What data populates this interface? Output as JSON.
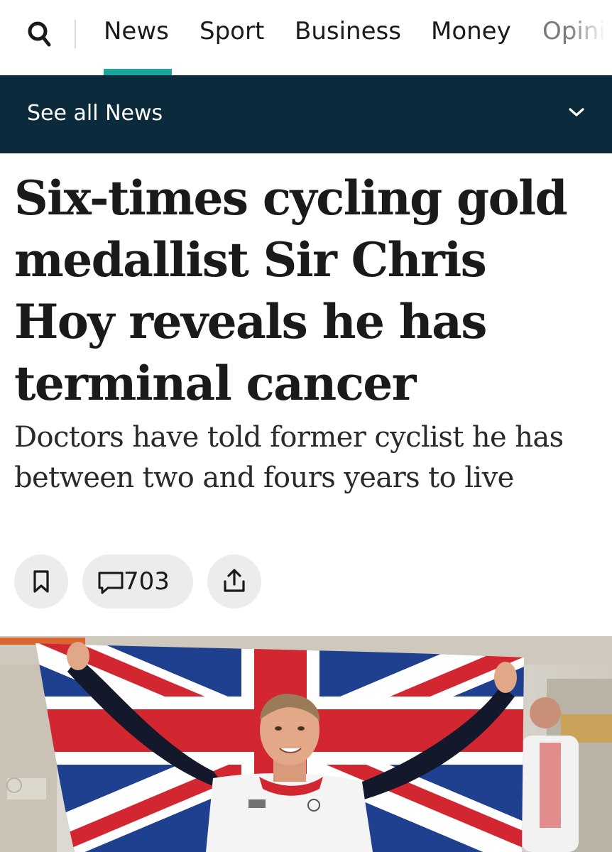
{
  "nav": {
    "items": [
      {
        "label": "News",
        "active": true
      },
      {
        "label": "Sport"
      },
      {
        "label": "Business"
      },
      {
        "label": "Money"
      },
      {
        "label": "Opinion",
        "truncated": true
      }
    ],
    "search_icon": "search-icon"
  },
  "subnav": {
    "label": "See all News",
    "icon": "chevron-down-icon"
  },
  "article": {
    "headline": "Six-times cycling gold medallist Sir Chris Hoy reveals he has terminal cancer",
    "standfirst": "Doctors have told former cyclist he has between two and fours years to live",
    "actions": {
      "save_icon": "bookmark-icon",
      "comment_icon": "comment-icon",
      "comment_count": "703",
      "share_icon": "share-icon"
    }
  },
  "colors": {
    "accent": "#19a79a",
    "subnav_bg": "#0b2a3c",
    "button_bg": "#ececec"
  }
}
